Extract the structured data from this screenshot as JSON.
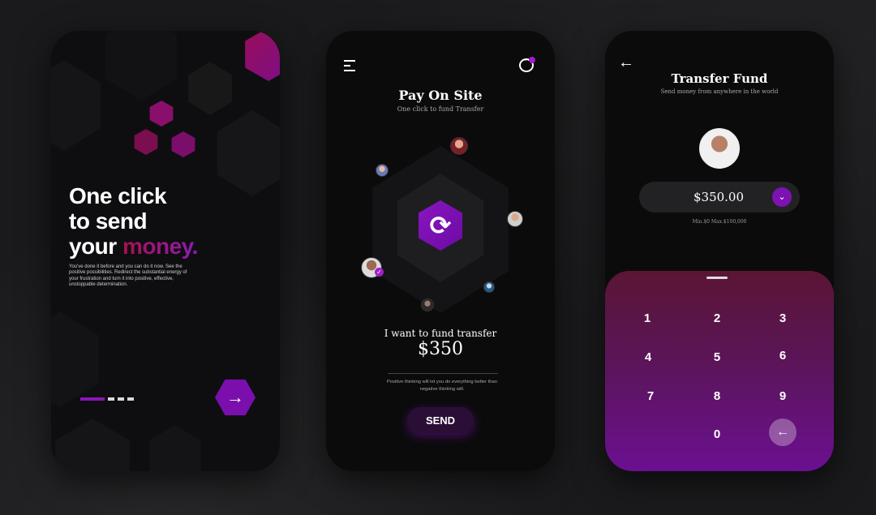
{
  "onboarding": {
    "headline": [
      "One click",
      "to send",
      "your"
    ],
    "headline_accent": "money.",
    "body": "You've done it before and you can do it now. See the positive possibilities. Redirect the substantial energy of your frustration and turn it into positive, effective, unstoppable determination.",
    "next_icon": "→"
  },
  "pay": {
    "title": "Pay On Site",
    "subtitle": "One click to fund Transfer",
    "swap_icon": "⟳",
    "check_icon": "✓",
    "fund_label": "I want to fund transfer",
    "amount": "$350",
    "note": "Positive thinking will let you do everything better than negative thinking will.",
    "send_label": "SEND"
  },
  "transfer": {
    "back_icon": "←",
    "title": "Transfer Fund",
    "subtitle": "Send money from anywhere in the world",
    "amount": "$350.00",
    "caret_icon": "⌄",
    "limits": "Min.$0  Max.$100,000",
    "keys": [
      "1",
      "2",
      "3",
      "4",
      "5",
      "6",
      "7",
      "8",
      "9",
      "0"
    ],
    "back_key_icon": "←"
  },
  "colors": {
    "accent": "#7c12b2",
    "accent_red": "#a6114f",
    "bg": "#1a1a1c"
  }
}
